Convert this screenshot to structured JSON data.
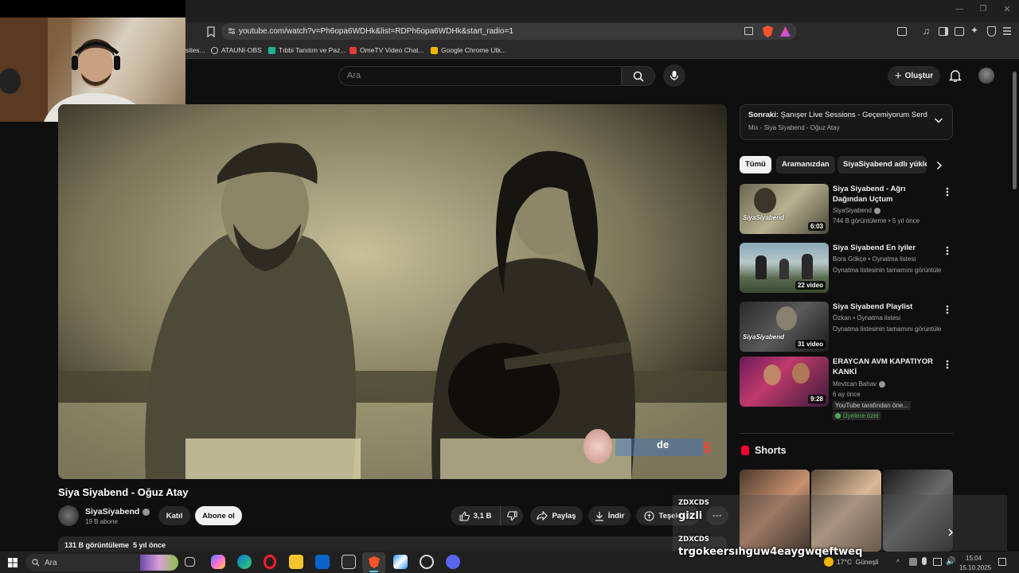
{
  "browser": {
    "url": "youtube.com/watch?v=Ph6opa6WDHk&list=RDPh6opa6WDHk&start_radio=1",
    "bookmarks": [
      {
        "label": "sites...",
        "icon": "page-icon"
      },
      {
        "label": "ATAUNI-OBS",
        "icon": "globe-icon"
      },
      {
        "label": "Tıbbi Tanıtım ve Paz...",
        "icon": "app-icon"
      },
      {
        "label": "OmeTV Video Chat...",
        "icon": "video-icon"
      },
      {
        "label": "Google Chrome Utk...",
        "icon": "folder-icon"
      }
    ]
  },
  "youtube": {
    "search_placeholder": "Ara",
    "create_label": "Oluştur"
  },
  "video": {
    "title": "Siya Siyabend - Oğuz Atay",
    "channel": "SiyaSiyabend",
    "subscribers": "19 B abone",
    "join_label": "Katıl",
    "subscribe_label": "Abone ol",
    "likes": "3,1 B",
    "share_label": "Paylaş",
    "download_label": "İndir",
    "thanks_label": "Teşekkür",
    "views_line": "131 B görüntüleme  5 yıl önce",
    "watermark": "de"
  },
  "sidebar": {
    "next_prefix": "Sonraki:",
    "next_title": "Şanışer Live Sessions - Geçemiyorum Serd...",
    "next_sub": "Mix - Siya Siyabend - Oğuz Atay",
    "chips": [
      "Tümü",
      "Aramanızdan",
      "SiyaSiyabend adlı yükle"
    ],
    "recs": [
      {
        "title": "Siya Siyabend - Ağrı Dağından Uçtum",
        "line1": "SiyaSiyabend",
        "line2": "744 B görüntüleme • 5 yıl önce",
        "badge": "6:03",
        "thumb_text": "SiyaSiyabend"
      },
      {
        "title": "Siya Siyabend En iyiler",
        "line1": "Bora Gökçe • Oynatma listesi",
        "line2": "Oynatma listesinin tamamını görüntüle",
        "badge": "22 video"
      },
      {
        "title": "Siya Siyabend Playlist",
        "line1": "Özkan • Oynatma listesi",
        "line2": "Oynatma listesinin tamamını görüntüle",
        "badge": "31 video",
        "thumb_text": "SiyaSiyabend"
      },
      {
        "title": "ERAYCAN AVM KAPATIYOR KANKİ",
        "line1": "Mevtcan Bahav",
        "line2": "6 ay önce",
        "line3": "YouTube tarafından öne...",
        "line4": "Üyelere özel",
        "badge": "9:28"
      }
    ],
    "shorts_label": "Shorts"
  },
  "chat": [
    {
      "user": "ZDXCDS",
      "message": "gizli"
    },
    {
      "user": "ZDXCDS",
      "message": "trgokeersıhguw4eaygwqeftweq"
    }
  ],
  "taskbar": {
    "search_label": "Ara",
    "weather": "17°C  Güneşli",
    "time": "15:04",
    "date": "15.10.2025"
  },
  "colors": {
    "youtube_red": "#ff0033",
    "background": "#0f0f0f",
    "accent_green": "#3ea6ff"
  }
}
